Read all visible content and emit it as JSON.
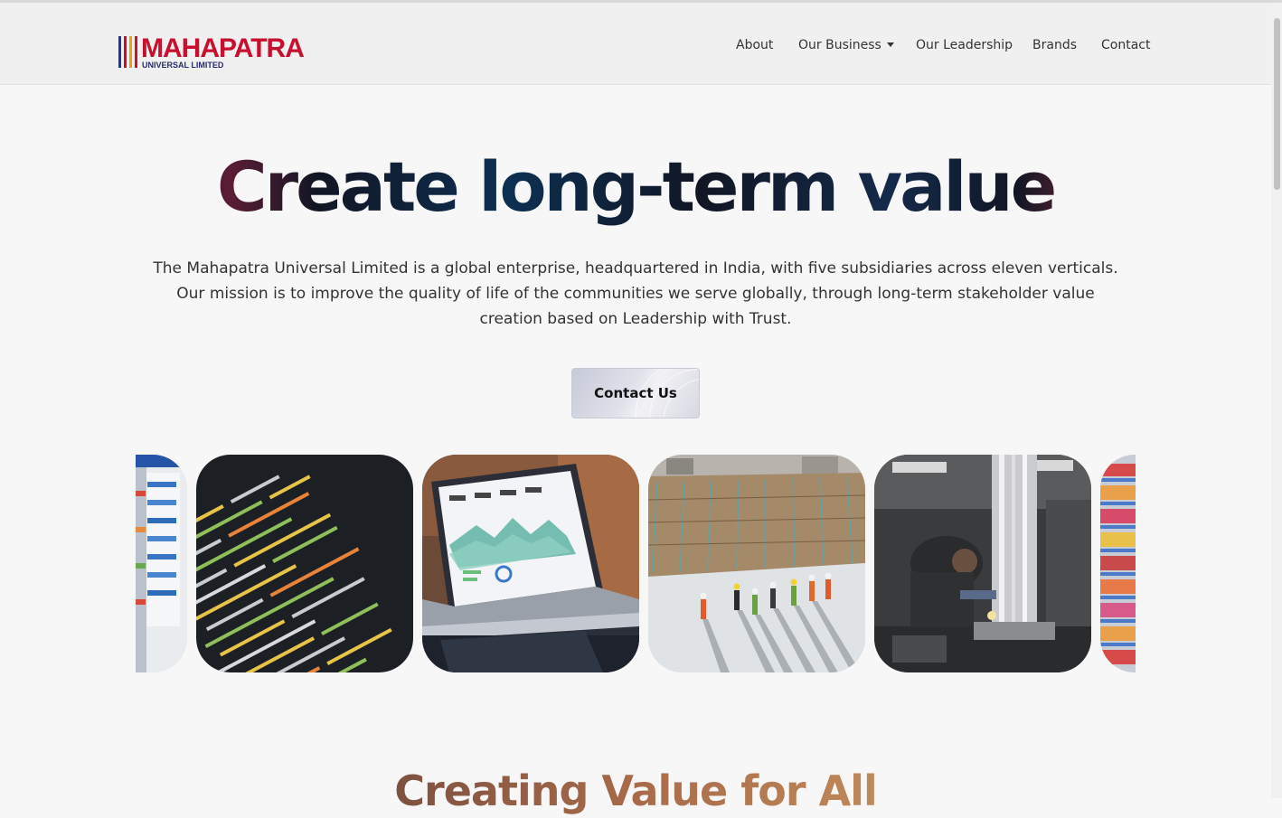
{
  "header": {
    "logo_text": "MAHAPATRA",
    "logo_subtext": "UNIVERSAL LIMITED",
    "nav": [
      "About",
      "Our Business",
      "Our Leadership",
      "Brands",
      "Contact"
    ]
  },
  "hero": {
    "title": "Create long-term value",
    "description": "The Mahapatra Universal Limited is a global enterprise, headquartered in India, with five subsidiaries across eleven verticals. Our mission is to improve the quality of life of the communities we serve globally, through long-term stakeholder value creation based on Leadership with Trust.",
    "cta_label": "Contact Us"
  },
  "gallery": {
    "images": [
      "retail-store-image",
      "code-screen-image",
      "laptop-dashboard-image",
      "construction-site-image",
      "factory-worker-image",
      "retail-shelves-image"
    ]
  },
  "next_section": {
    "title": "Creating Value for All"
  },
  "colors": {
    "brand_red": "#c8102e",
    "brand_blue": "#1a3a9a",
    "brand_orange": "#f39c12",
    "page_bg": "#f7f7f7"
  }
}
